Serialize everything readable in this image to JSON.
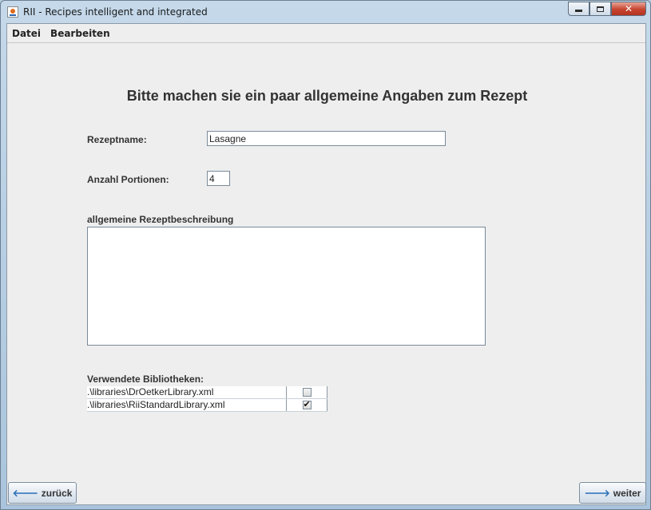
{
  "window": {
    "title": "RII - Recipes intelligent and integrated",
    "controls": {
      "minimize": "minimize",
      "maximize": "maximize",
      "close": "✕"
    }
  },
  "menubar": {
    "items": [
      "Datei",
      "Bearbeiten"
    ]
  },
  "form": {
    "heading": "Bitte machen sie ein paar allgemeine Angaben zum Rezept",
    "recipe_name_label": "Rezeptname:",
    "recipe_name_value": "Lasagne",
    "portions_label": "Anzahl Portionen:",
    "portions_value": "4",
    "description_label": "allgemeine Rezeptbeschreibung",
    "description_value": "",
    "libraries_label": "Verwendete Bibliotheken:",
    "libraries": [
      {
        "path": ".\\libraries\\DrOetkerLibrary.xml",
        "checked": false
      },
      {
        "path": ".\\libraries\\RiiStandardLibrary.xml",
        "checked": true
      }
    ]
  },
  "nav": {
    "back_label": "zurück",
    "next_label": "weiter",
    "back_icon": "arrow-left-icon",
    "next_icon": "arrow-right-icon"
  },
  "colors": {
    "accent": "#2a6fb8",
    "window_frame": "#a9c4dc",
    "panel": "#eeeeee"
  }
}
